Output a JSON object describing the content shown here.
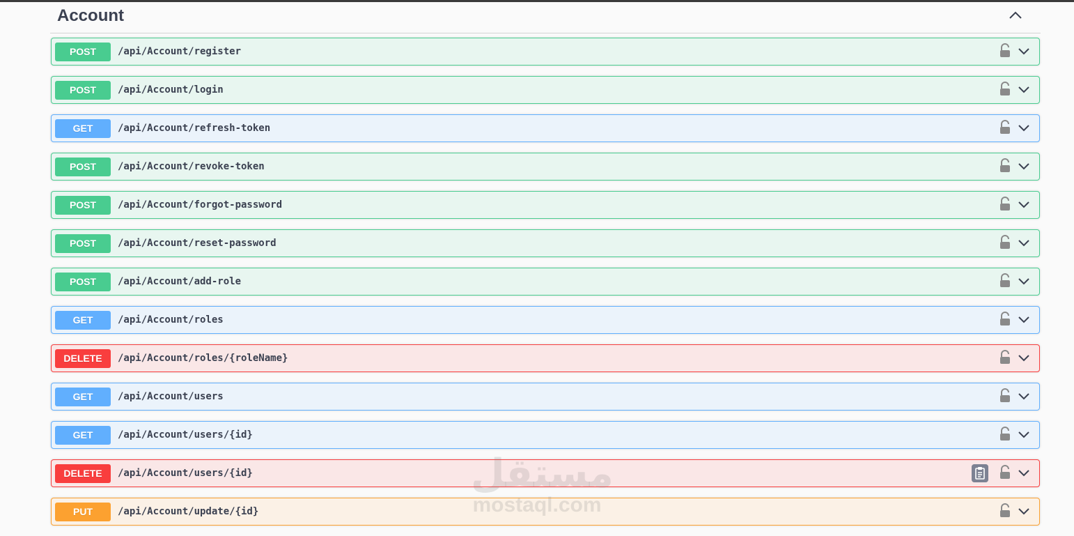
{
  "section": {
    "title": "Account"
  },
  "operations": [
    {
      "method": "POST",
      "path": "/api/Account/register"
    },
    {
      "method": "POST",
      "path": "/api/Account/login"
    },
    {
      "method": "GET",
      "path": "/api/Account/refresh-token"
    },
    {
      "method": "POST",
      "path": "/api/Account/revoke-token"
    },
    {
      "method": "POST",
      "path": "/api/Account/forgot-password"
    },
    {
      "method": "POST",
      "path": "/api/Account/reset-password"
    },
    {
      "method": "POST",
      "path": "/api/Account/add-role"
    },
    {
      "method": "GET",
      "path": "/api/Account/roles"
    },
    {
      "method": "DELETE",
      "path": "/api/Account/roles/{roleName}"
    },
    {
      "method": "GET",
      "path": "/api/Account/users"
    },
    {
      "method": "GET",
      "path": "/api/Account/users/{id}"
    },
    {
      "method": "DELETE",
      "path": "/api/Account/users/{id}"
    },
    {
      "method": "PUT",
      "path": "/api/Account/update/{id}"
    }
  ],
  "icons": {
    "lock": "unlocked-padlock-icon",
    "chevron": "chevron-down-icon",
    "collapse": "chevron-up-icon",
    "copy": "clipboard-copy-icon"
  },
  "colors": {
    "post": "#49cc90",
    "get": "#61affe",
    "delete": "#f93e3e",
    "put": "#fca130"
  },
  "watermark": {
    "arabic": "مستقل",
    "latin": "mostaql.com"
  }
}
